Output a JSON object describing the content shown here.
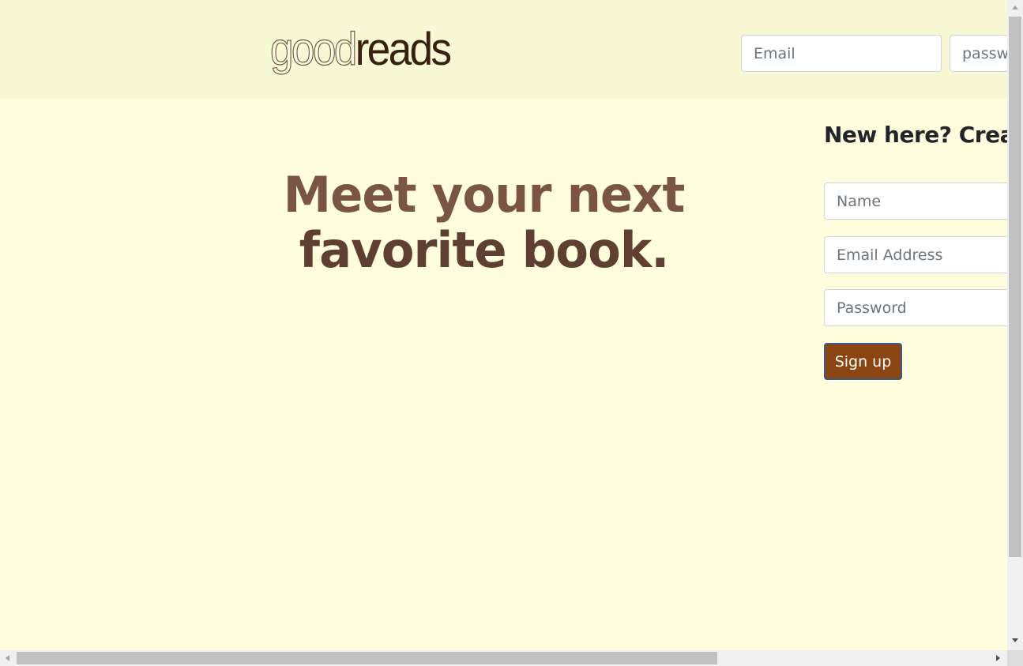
{
  "header": {
    "logo": {
      "light": "good",
      "dark": "reads"
    },
    "email_placeholder": "Email",
    "password_placeholder": "password"
  },
  "hero": {
    "line1": "Meet your next",
    "line2": "favorite book."
  },
  "signup": {
    "title": "New here? Create a free account!",
    "name_placeholder": "Name",
    "email_placeholder": "Email Address",
    "password_placeholder": "Password",
    "button_label": "Sign up"
  },
  "colors": {
    "header_bg": "#f9f8d4",
    "page_bg": "#fffdde",
    "button_bg": "#8b4513",
    "headline": "#6b4736"
  },
  "icons": {
    "scroll_up": "triangle-up-icon",
    "scroll_down": "triangle-down-icon",
    "scroll_left": "triangle-left-icon",
    "scroll_right": "triangle-right-icon"
  }
}
